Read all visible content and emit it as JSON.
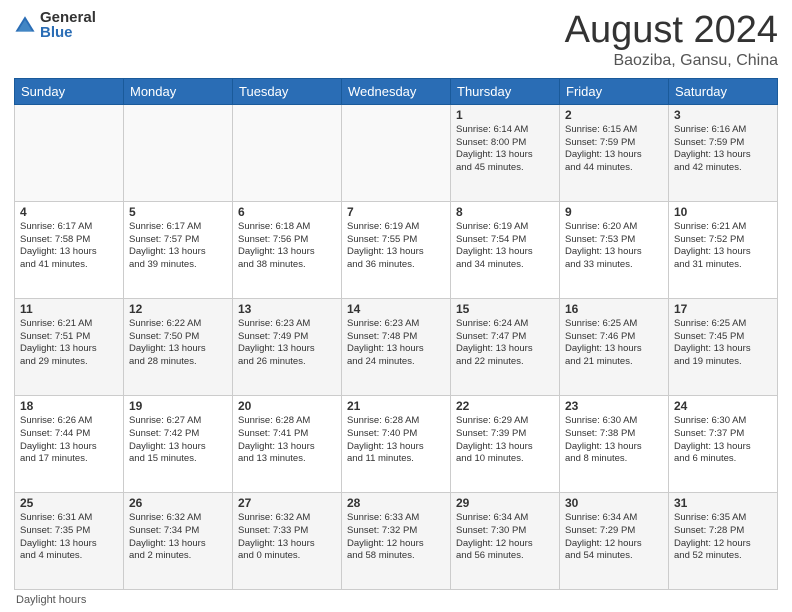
{
  "logo": {
    "general": "General",
    "blue": "Blue"
  },
  "title": "August 2024",
  "subtitle": "Baoziba, Gansu, China",
  "days_header": [
    "Sunday",
    "Monday",
    "Tuesday",
    "Wednesday",
    "Thursday",
    "Friday",
    "Saturday"
  ],
  "weeks": [
    [
      {
        "day": "",
        "info": ""
      },
      {
        "day": "",
        "info": ""
      },
      {
        "day": "",
        "info": ""
      },
      {
        "day": "",
        "info": ""
      },
      {
        "day": "1",
        "info": "Sunrise: 6:14 AM\nSunset: 8:00 PM\nDaylight: 13 hours\nand 45 minutes."
      },
      {
        "day": "2",
        "info": "Sunrise: 6:15 AM\nSunset: 7:59 PM\nDaylight: 13 hours\nand 44 minutes."
      },
      {
        "day": "3",
        "info": "Sunrise: 6:16 AM\nSunset: 7:59 PM\nDaylight: 13 hours\nand 42 minutes."
      }
    ],
    [
      {
        "day": "4",
        "info": "Sunrise: 6:17 AM\nSunset: 7:58 PM\nDaylight: 13 hours\nand 41 minutes."
      },
      {
        "day": "5",
        "info": "Sunrise: 6:17 AM\nSunset: 7:57 PM\nDaylight: 13 hours\nand 39 minutes."
      },
      {
        "day": "6",
        "info": "Sunrise: 6:18 AM\nSunset: 7:56 PM\nDaylight: 13 hours\nand 38 minutes."
      },
      {
        "day": "7",
        "info": "Sunrise: 6:19 AM\nSunset: 7:55 PM\nDaylight: 13 hours\nand 36 minutes."
      },
      {
        "day": "8",
        "info": "Sunrise: 6:19 AM\nSunset: 7:54 PM\nDaylight: 13 hours\nand 34 minutes."
      },
      {
        "day": "9",
        "info": "Sunrise: 6:20 AM\nSunset: 7:53 PM\nDaylight: 13 hours\nand 33 minutes."
      },
      {
        "day": "10",
        "info": "Sunrise: 6:21 AM\nSunset: 7:52 PM\nDaylight: 13 hours\nand 31 minutes."
      }
    ],
    [
      {
        "day": "11",
        "info": "Sunrise: 6:21 AM\nSunset: 7:51 PM\nDaylight: 13 hours\nand 29 minutes."
      },
      {
        "day": "12",
        "info": "Sunrise: 6:22 AM\nSunset: 7:50 PM\nDaylight: 13 hours\nand 28 minutes."
      },
      {
        "day": "13",
        "info": "Sunrise: 6:23 AM\nSunset: 7:49 PM\nDaylight: 13 hours\nand 26 minutes."
      },
      {
        "day": "14",
        "info": "Sunrise: 6:23 AM\nSunset: 7:48 PM\nDaylight: 13 hours\nand 24 minutes."
      },
      {
        "day": "15",
        "info": "Sunrise: 6:24 AM\nSunset: 7:47 PM\nDaylight: 13 hours\nand 22 minutes."
      },
      {
        "day": "16",
        "info": "Sunrise: 6:25 AM\nSunset: 7:46 PM\nDaylight: 13 hours\nand 21 minutes."
      },
      {
        "day": "17",
        "info": "Sunrise: 6:25 AM\nSunset: 7:45 PM\nDaylight: 13 hours\nand 19 minutes."
      }
    ],
    [
      {
        "day": "18",
        "info": "Sunrise: 6:26 AM\nSunset: 7:44 PM\nDaylight: 13 hours\nand 17 minutes."
      },
      {
        "day": "19",
        "info": "Sunrise: 6:27 AM\nSunset: 7:42 PM\nDaylight: 13 hours\nand 15 minutes."
      },
      {
        "day": "20",
        "info": "Sunrise: 6:28 AM\nSunset: 7:41 PM\nDaylight: 13 hours\nand 13 minutes."
      },
      {
        "day": "21",
        "info": "Sunrise: 6:28 AM\nSunset: 7:40 PM\nDaylight: 13 hours\nand 11 minutes."
      },
      {
        "day": "22",
        "info": "Sunrise: 6:29 AM\nSunset: 7:39 PM\nDaylight: 13 hours\nand 10 minutes."
      },
      {
        "day": "23",
        "info": "Sunrise: 6:30 AM\nSunset: 7:38 PM\nDaylight: 13 hours\nand 8 minutes."
      },
      {
        "day": "24",
        "info": "Sunrise: 6:30 AM\nSunset: 7:37 PM\nDaylight: 13 hours\nand 6 minutes."
      }
    ],
    [
      {
        "day": "25",
        "info": "Sunrise: 6:31 AM\nSunset: 7:35 PM\nDaylight: 13 hours\nand 4 minutes."
      },
      {
        "day": "26",
        "info": "Sunrise: 6:32 AM\nSunset: 7:34 PM\nDaylight: 13 hours\nand 2 minutes."
      },
      {
        "day": "27",
        "info": "Sunrise: 6:32 AM\nSunset: 7:33 PM\nDaylight: 13 hours\nand 0 minutes."
      },
      {
        "day": "28",
        "info": "Sunrise: 6:33 AM\nSunset: 7:32 PM\nDaylight: 12 hours\nand 58 minutes."
      },
      {
        "day": "29",
        "info": "Sunrise: 6:34 AM\nSunset: 7:30 PM\nDaylight: 12 hours\nand 56 minutes."
      },
      {
        "day": "30",
        "info": "Sunrise: 6:34 AM\nSunset: 7:29 PM\nDaylight: 12 hours\nand 54 minutes."
      },
      {
        "day": "31",
        "info": "Sunrise: 6:35 AM\nSunset: 7:28 PM\nDaylight: 12 hours\nand 52 minutes."
      }
    ]
  ],
  "footer": "Daylight hours"
}
